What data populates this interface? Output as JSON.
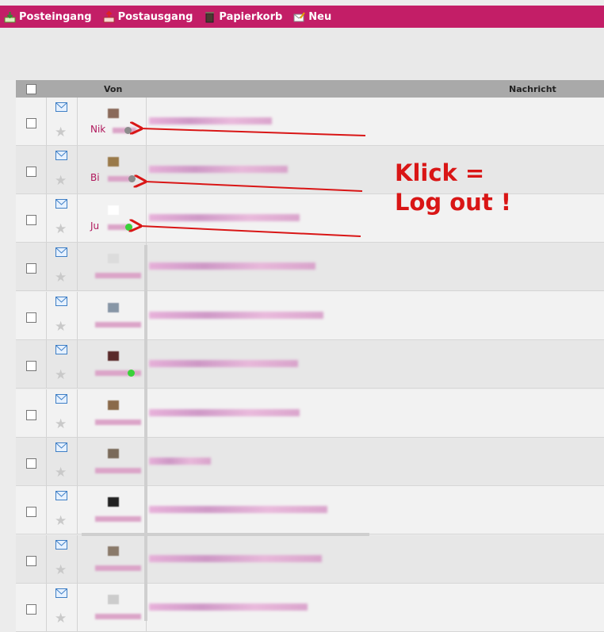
{
  "nav": {
    "items": [
      {
        "label": "Posteingang",
        "icon": "inbox-icon"
      },
      {
        "label": "Postausgang",
        "icon": "outbox-icon"
      },
      {
        "label": "Papierkorb",
        "icon": "trash-icon"
      },
      {
        "label": "Neu",
        "icon": "new-message-icon"
      }
    ]
  },
  "table": {
    "headers": {
      "from": "Von",
      "message": "Nachricht"
    },
    "rows": [
      {
        "name_visible": "Nik",
        "status": "grey"
      },
      {
        "name_visible": "Bi",
        "status": "grey"
      },
      {
        "name_visible": "Ju",
        "status": "green"
      },
      {
        "name_visible": "",
        "status": "none"
      },
      {
        "name_visible": "",
        "status": "none"
      },
      {
        "name_visible": "",
        "status": "green"
      },
      {
        "name_visible": "",
        "status": "none"
      },
      {
        "name_visible": "",
        "status": "none"
      },
      {
        "name_visible": "",
        "status": "none"
      },
      {
        "name_visible": "",
        "status": "none"
      },
      {
        "name_visible": "",
        "status": "none"
      }
    ]
  },
  "annotation": {
    "line1": "Klick =",
    "line2": "Log out !",
    "color": "#d91616"
  },
  "colors": {
    "brand": "#c31e67",
    "online": "#3ad13a",
    "offline": "#8c8c8c"
  }
}
